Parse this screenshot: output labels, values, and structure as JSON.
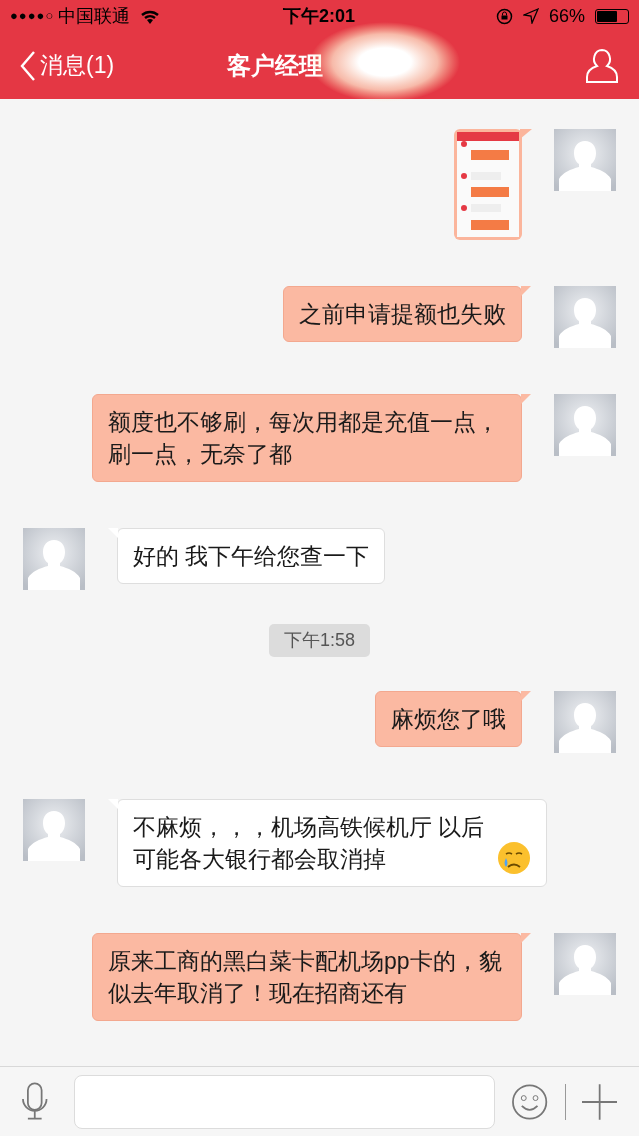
{
  "status_bar": {
    "signal_dots": "●●●●○",
    "carrier": "中国联通",
    "time": "下午2:01",
    "battery": "66%"
  },
  "nav": {
    "back": "消息(1)",
    "title": "客户经理"
  },
  "messages": [
    {
      "kind": "image",
      "incoming": false
    },
    {
      "kind": "text",
      "incoming": false,
      "text": "之前申请提额也失败",
      "ends_with_emoji": false
    },
    {
      "kind": "text",
      "incoming": false,
      "text": "额度也不够刷，每次用都是充值一点，刷一点，无奈了都",
      "ends_with_emoji": false
    },
    {
      "kind": "text",
      "incoming": true,
      "text": "好的 我下午给您查一下",
      "ends_with_emoji": false
    },
    {
      "kind": "time",
      "text": "下午1:58"
    },
    {
      "kind": "text",
      "incoming": false,
      "text": "麻烦您了哦",
      "ends_with_emoji": false
    },
    {
      "kind": "text",
      "incoming": true,
      "text": "不麻烦，，，机场高铁候机厅 以后可能各大银行都会取消掉",
      "ends_with_emoji": true
    },
    {
      "kind": "text",
      "incoming": false,
      "text": "原来工商的黑白菜卡配机场pp卡的，貌似去年取消了！现在招商还有",
      "ends_with_emoji": false
    }
  ]
}
